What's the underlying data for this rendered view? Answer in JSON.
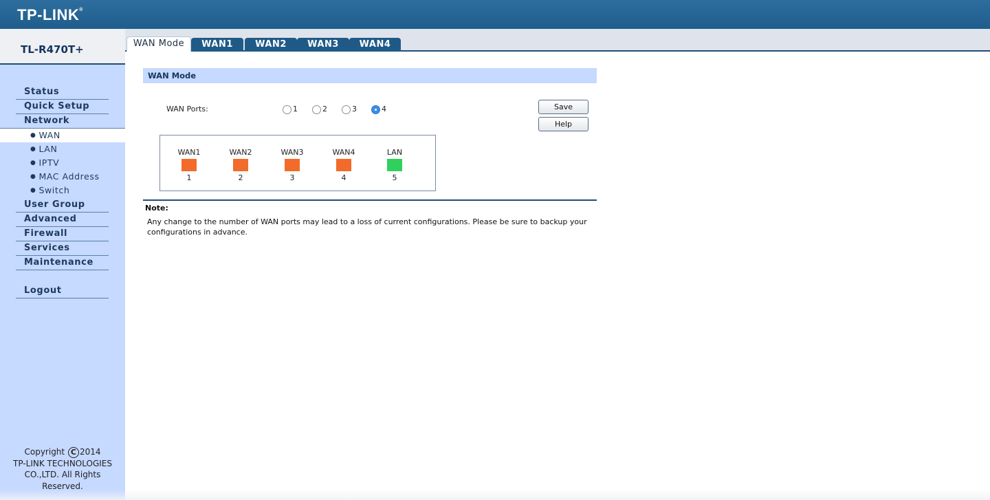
{
  "header": {
    "logo_text": "TP-LINK",
    "logo_mark": "®"
  },
  "sidebar": {
    "model": "TL-R470T+",
    "items": [
      {
        "label": "Status"
      },
      {
        "label": "Quick Setup"
      },
      {
        "label": "Network"
      },
      {
        "label": "WAN",
        "sub": true
      },
      {
        "label": "LAN",
        "sub": true
      },
      {
        "label": "IPTV",
        "sub": true
      },
      {
        "label": "MAC Address",
        "sub": true
      },
      {
        "label": "Switch",
        "sub": true
      },
      {
        "label": "User Group"
      },
      {
        "label": "Advanced"
      },
      {
        "label": "Firewall"
      },
      {
        "label": "Services"
      },
      {
        "label": "Maintenance"
      },
      {
        "label": "Logout"
      }
    ],
    "copyright_line1_pre": "Copyright",
    "copyright_symbol": "C",
    "copyright_year": "2014",
    "copyright_line2": "TP-LINK TECHNOLOGIES",
    "copyright_line3": "CO.,LTD. All Rights",
    "copyright_line4": "Reserved."
  },
  "tabs": [
    {
      "label": "WAN Mode",
      "active": true
    },
    {
      "label": "WAN1"
    },
    {
      "label": "WAN2"
    },
    {
      "label": "WAN3"
    },
    {
      "label": "WAN4"
    }
  ],
  "main": {
    "section_title": "WAN Mode",
    "wan_ports_label": "WAN Ports:",
    "wan_options": [
      "1",
      "2",
      "3",
      "4"
    ],
    "wan_selected": "4",
    "save_label": "Save",
    "help_label": "Help",
    "ports": [
      {
        "label": "WAN1",
        "num": "1",
        "color": "#f26b2a"
      },
      {
        "label": "WAN2",
        "num": "2",
        "color": "#f26b2a"
      },
      {
        "label": "WAN3",
        "num": "3",
        "color": "#f26b2a"
      },
      {
        "label": "WAN4",
        "num": "4",
        "color": "#f26b2a"
      },
      {
        "label": "LAN",
        "num": "5",
        "color": "#2fd15c"
      }
    ],
    "note_title": "Note:",
    "note_text": "Any change to the number of WAN ports may lead to a loss of current configurations. Please be sure to backup your configurations in advance."
  }
}
